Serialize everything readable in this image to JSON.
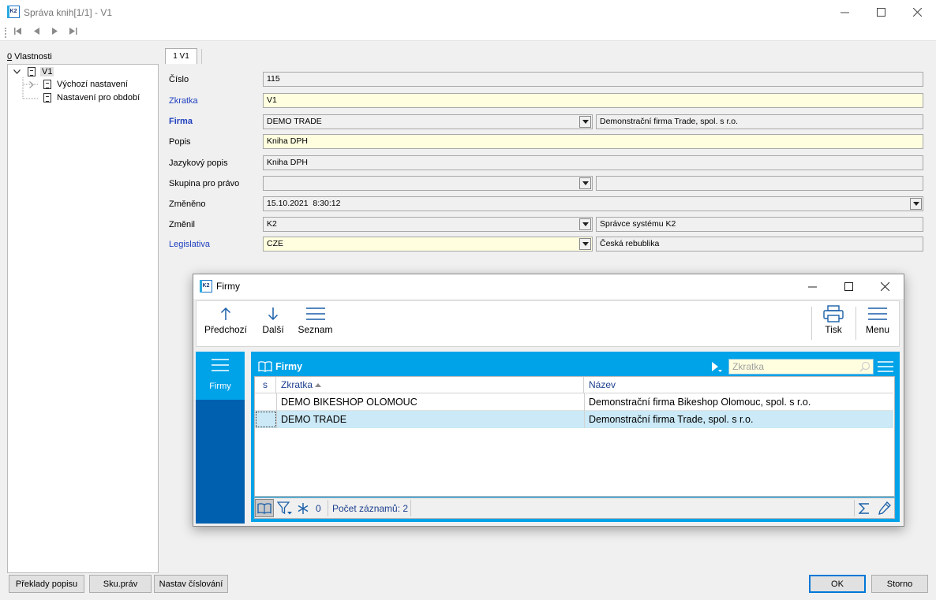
{
  "window": {
    "title": "Správa knih[1/1] - V1",
    "logo_text": "K2"
  },
  "left_panel": {
    "label_prefix": "0",
    "label_rest": " Vlastnosti",
    "tree": {
      "root": "V1",
      "children": [
        "Výchozí nastavení",
        "Nastavení pro období"
      ]
    }
  },
  "form": {
    "tab": "1 V1",
    "rows": {
      "cislo": {
        "label": "Číslo",
        "value": "115"
      },
      "zkratka": {
        "label": "Zkratka",
        "value": "V1"
      },
      "firma": {
        "label": "Firma",
        "value": "DEMO TRADE",
        "desc": "Demonstrační firma Trade, spol. s r.o."
      },
      "popis": {
        "label": "Popis",
        "value": "Kniha DPH"
      },
      "jazykovy": {
        "label": "Jazykový popis",
        "value": "Kniha DPH"
      },
      "skupina": {
        "label": "Skupina pro právo",
        "value": "",
        "desc": ""
      },
      "zmeneno": {
        "label": "Změněno",
        "value": "15.10.2021  8:30:12"
      },
      "zmenil": {
        "label": "Změnil",
        "value": "K2",
        "desc": "Správce systému K2"
      },
      "legislativa": {
        "label": "Legislativa",
        "value": "CZE",
        "desc": "Česká rebublika"
      }
    }
  },
  "bottom_buttons": {
    "preklady": "Překlady popisu",
    "sku": "Sku.práv",
    "nastav": "Nastav číslování",
    "ok": "OK",
    "storno": "Storno"
  },
  "dialog": {
    "title": "Firmy",
    "toolbar": {
      "prev": "Předchozí",
      "next": "Další",
      "list": "Seznam",
      "print": "Tisk",
      "menu": "Menu"
    },
    "sidebar_label": "Firmy",
    "grid": {
      "title": "Firmy",
      "search_placeholder": "Zkratka",
      "columns": {
        "s": "s",
        "zkratka": "Zkratka",
        "nazev": "Název"
      },
      "rows": [
        {
          "zkratka": "DEMO BIKESHOP OLOMOUC",
          "nazev": "Demonstrační firma Bikeshop Olomouc, spol. s r.o."
        },
        {
          "zkratka": "DEMO TRADE",
          "nazev": "Demonstrační firma Trade, spol. s r.o."
        }
      ],
      "footer": {
        "marked_count": "0",
        "record_count": "Počet záznamů: 2"
      }
    }
  },
  "colors": {
    "accent": "#00a2e8",
    "sidebar_dark": "#0060b0",
    "field_required": "#ffffe0",
    "selected_row": "#cbe9f6",
    "label_blue": "#1f3fbf"
  }
}
